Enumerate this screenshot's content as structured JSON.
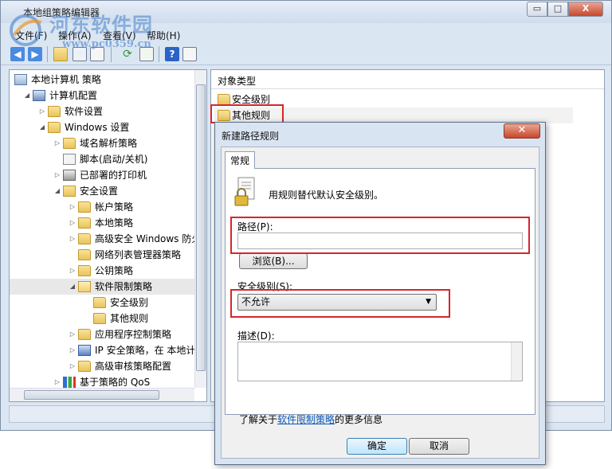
{
  "window": {
    "title": "本地组策略编辑器",
    "min_symbol": "▭",
    "max_symbol": "□",
    "close_symbol": "X"
  },
  "menu": {
    "items": [
      "文件(F)",
      "操作(A)",
      "查看(V)",
      "帮助(H)"
    ]
  },
  "watermark": {
    "site_name": "河东软件园",
    "url": "www.pc0359.cn"
  },
  "toolbar": {
    "icons": [
      "back-icon",
      "forward-icon",
      "up-icon",
      "show-hide-tree-icon",
      "properties-icon",
      "refresh-icon",
      "export-icon",
      "help-icon",
      "view-icon"
    ]
  },
  "tree": {
    "items": [
      {
        "label": "本地计算机 策略",
        "icon": "computer-policy-icon",
        "level": 0,
        "arrow": ""
      },
      {
        "label": "计算机配置",
        "icon": "computer-icon",
        "level": 1,
        "arrow": "◢"
      },
      {
        "label": "软件设置",
        "icon": "folder-icon",
        "level": 2,
        "arrow": "▷"
      },
      {
        "label": "Windows 设置",
        "icon": "folder-icon",
        "level": 2,
        "arrow": "◢"
      },
      {
        "label": "域名解析策略",
        "icon": "folder-icon",
        "level": 3,
        "arrow": "▷"
      },
      {
        "label": "脚本(启动/关机)",
        "icon": "script-icon",
        "level": 3,
        "arrow": ""
      },
      {
        "label": "已部署的打印机",
        "icon": "printer-icon",
        "level": 3,
        "arrow": "▷"
      },
      {
        "label": "安全设置",
        "icon": "security-icon",
        "level": 3,
        "arrow": "◢"
      },
      {
        "label": "帐户策略",
        "icon": "folder-icon",
        "level": 4,
        "arrow": "▷"
      },
      {
        "label": "本地策略",
        "icon": "folder-icon",
        "level": 4,
        "arrow": "▷"
      },
      {
        "label": "高级安全 Windows 防火",
        "icon": "folder-icon",
        "level": 4,
        "arrow": "▷"
      },
      {
        "label": "网络列表管理器策略",
        "icon": "folder-icon",
        "level": 4,
        "arrow": ""
      },
      {
        "label": "公钥策略",
        "icon": "folder-icon",
        "level": 4,
        "arrow": "▷"
      },
      {
        "label": "软件限制策略",
        "icon": "folder-open-icon",
        "level": 4,
        "arrow": "◢",
        "selected": true
      },
      {
        "label": "安全级别",
        "icon": "folder-icon",
        "level": 5,
        "arrow": ""
      },
      {
        "label": "其他规则",
        "icon": "folder-icon",
        "level": 5,
        "arrow": ""
      },
      {
        "label": "应用程序控制策略",
        "icon": "folder-icon",
        "level": 4,
        "arrow": "▷"
      },
      {
        "label": "IP 安全策略，在 本地计",
        "icon": "ip-security-icon",
        "level": 4,
        "arrow": "▷"
      },
      {
        "label": "高级审核策略配置",
        "icon": "folder-icon",
        "level": 4,
        "arrow": "▷"
      },
      {
        "label": "基于策略的 QoS",
        "icon": "chart-icon",
        "level": 3,
        "arrow": "▷"
      }
    ]
  },
  "list": {
    "column_header": "对象类型",
    "rows": [
      {
        "label": "安全级别",
        "highlighted": false
      },
      {
        "label": "其他规则",
        "highlighted": true
      }
    ]
  },
  "dialog": {
    "title": "新建路径规则",
    "close_symbol": "✕",
    "tab_label": "常规",
    "intro_text": "用规则替代默认安全级别。",
    "path_label": "路径(P):",
    "path_value": "",
    "browse_label": "浏览(B)...",
    "level_label": "安全级别(S):",
    "level_value": "不允许",
    "desc_label": "描述(D):",
    "desc_value": "",
    "more_info_prefix": "了解关于",
    "more_info_link": "软件限制策略",
    "more_info_suffix": "的更多信息",
    "ok_label": "确定",
    "cancel_label": "取消"
  },
  "colors": {
    "highlight_box": "#d6262b",
    "link": "#0a57b4"
  }
}
